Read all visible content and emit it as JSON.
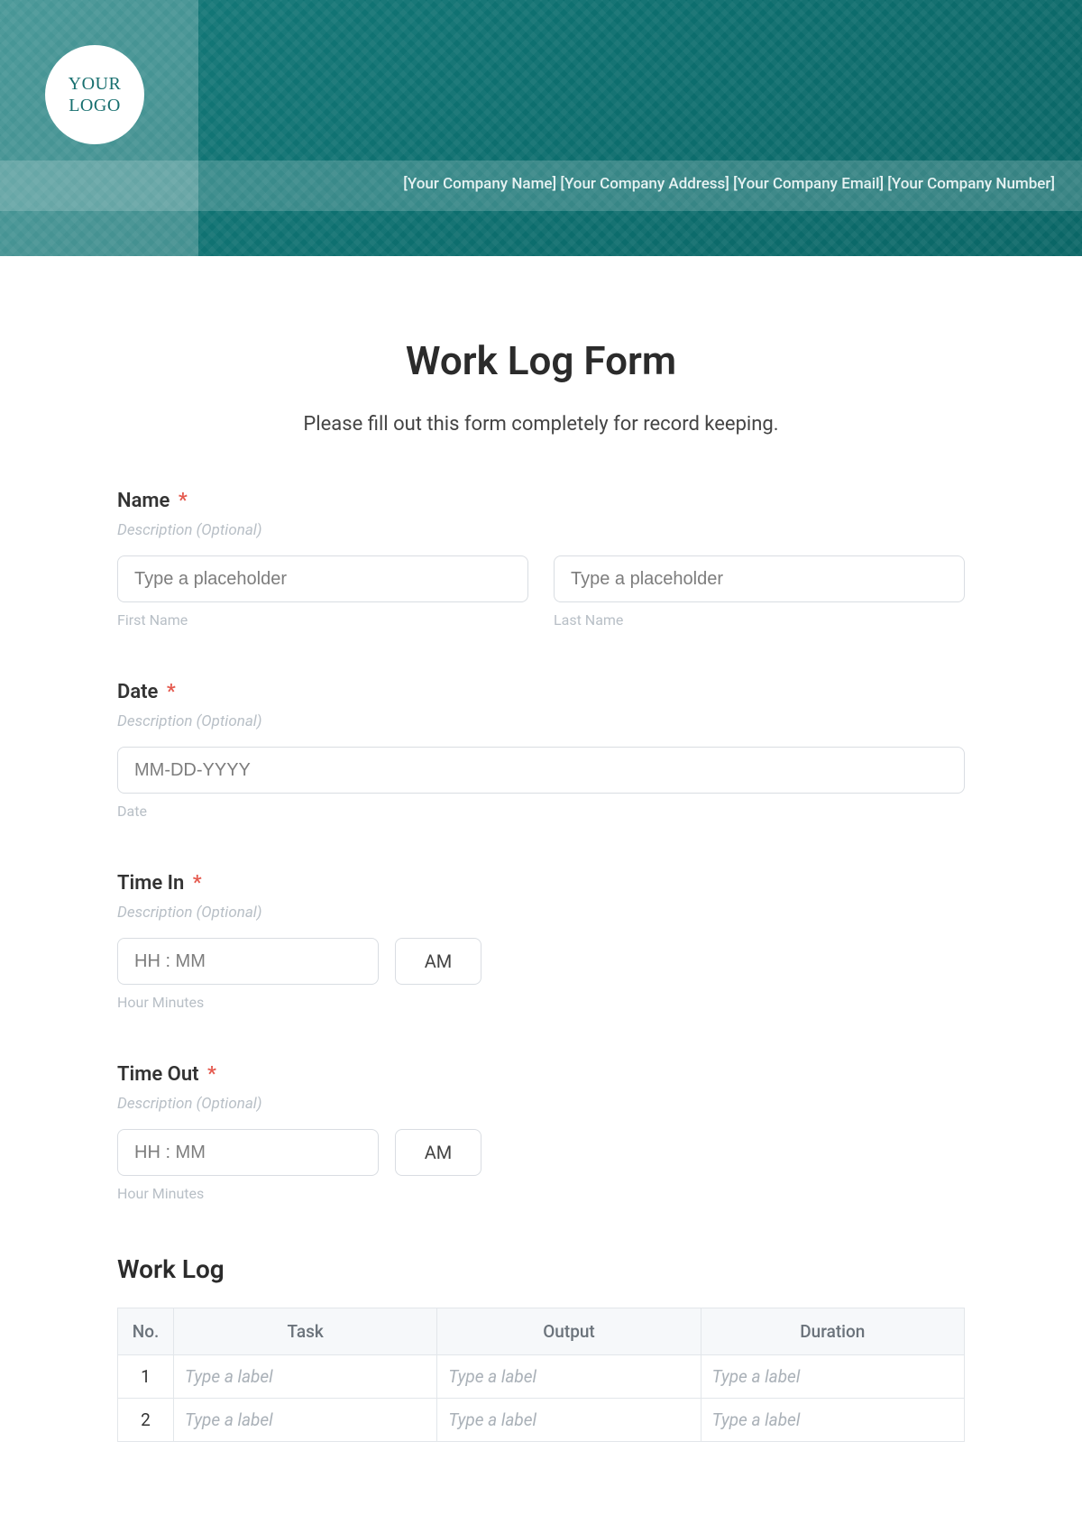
{
  "banner": {
    "logo_line1": "YOUR",
    "logo_line2": "LOGO",
    "company_line": "[Your Company Name] [Your Company Address] [Your Company Email] [Your Company Number]"
  },
  "form": {
    "title": "Work Log Form",
    "subtitle": "Please fill out this form completely for record keeping."
  },
  "fields": {
    "name": {
      "label": "Name",
      "required": "*",
      "desc": "Description (Optional)",
      "first_placeholder": "Type a placeholder",
      "first_sub": "First Name",
      "last_placeholder": "Type a placeholder",
      "last_sub": "Last Name"
    },
    "date": {
      "label": "Date",
      "required": "*",
      "desc": "Description (Optional)",
      "placeholder": "MM-DD-YYYY",
      "sub": "Date"
    },
    "time_in": {
      "label": "Time In",
      "required": "*",
      "desc": "Description (Optional)",
      "hhmm": "HH : MM",
      "ampm": "AM",
      "sub": "Hour Minutes"
    },
    "time_out": {
      "label": "Time Out",
      "required": "*",
      "desc": "Description (Optional)",
      "hhmm": "HH : MM",
      "ampm": "AM",
      "sub": "Hour Minutes"
    }
  },
  "worklog": {
    "title": "Work Log",
    "headers": {
      "no": "No.",
      "task": "Task",
      "output": "Output",
      "duration": "Duration"
    },
    "placeholder": "Type a label",
    "rows": [
      {
        "no": "1"
      },
      {
        "no": "2"
      }
    ]
  }
}
